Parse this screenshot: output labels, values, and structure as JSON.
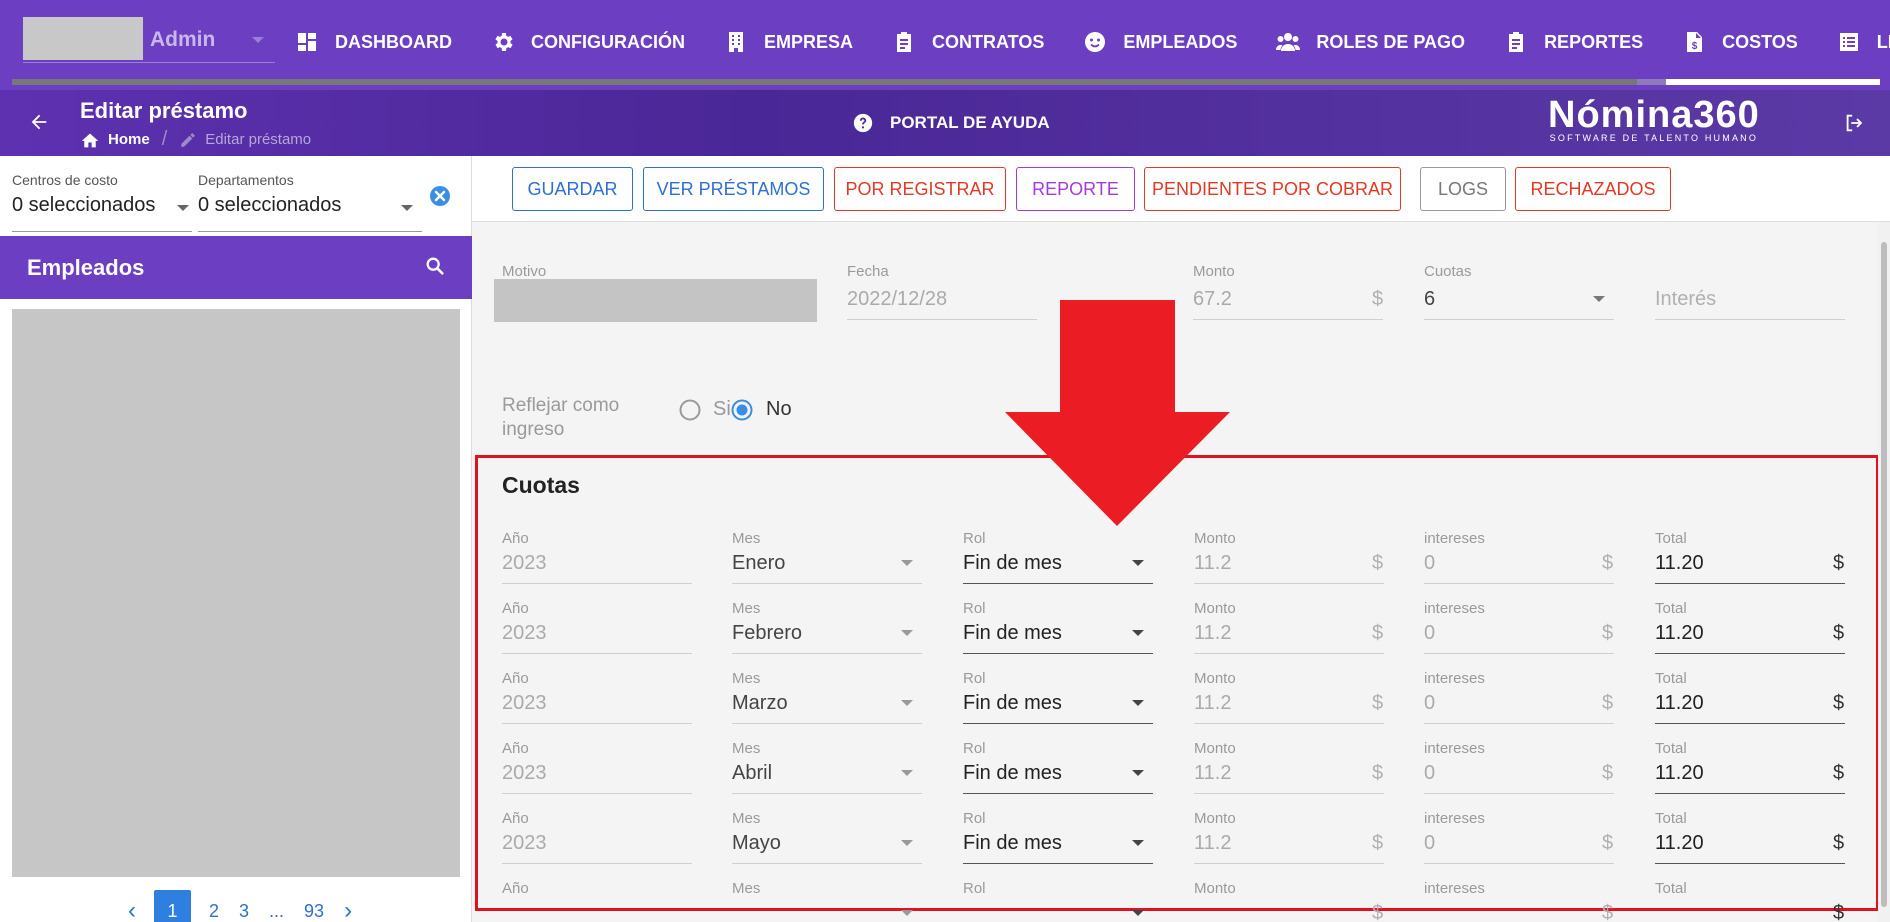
{
  "topnav": {
    "user": "Admin",
    "items": [
      {
        "label": "DASHBOARD",
        "icon": "dashboard-icon"
      },
      {
        "label": "CONFIGURACIÓN",
        "icon": "gear-icon"
      },
      {
        "label": "EMPRESA",
        "icon": "building-icon"
      },
      {
        "label": "CONTRATOS",
        "icon": "clipboard-icon"
      },
      {
        "label": "EMPLEADOS",
        "icon": "face-icon"
      },
      {
        "label": "ROLES DE PAGO",
        "icon": "people-icon"
      },
      {
        "label": "REPORTES",
        "icon": "clipboard-icon"
      },
      {
        "label": "COSTOS",
        "icon": "document-dollar-icon"
      },
      {
        "label": "LIQUIDACIONES",
        "icon": "list-icon"
      }
    ],
    "progress": 0.87
  },
  "header": {
    "title": "Editar préstamo",
    "breadcrumb_home": "Home",
    "breadcrumb_current": "Editar préstamo",
    "help": "PORTAL DE AYUDA",
    "logo": "Nómina360",
    "logo_sub": "SOFTWARE DE TALENTO HUMANO"
  },
  "filters": {
    "centros_label": "Centros de costo",
    "centros_value": "0 seleccionados",
    "departamentos_label": "Departamentos",
    "departamentos_value": "0 seleccionados"
  },
  "employees": {
    "title": "Empleados",
    "pages": [
      "1",
      "2",
      "3",
      "...",
      "93"
    ],
    "active_page": "1"
  },
  "toolbar": {
    "buttons": [
      "GUARDAR",
      "VER PRÉSTAMOS",
      "POR REGISTRAR",
      "REPORTE",
      "PENDIENTES POR COBRAR",
      "LOGS",
      "RECHAZADOS"
    ]
  },
  "loan": {
    "motivo_label": "Motivo",
    "fecha_label": "Fecha",
    "fecha_value": "2022/12/28",
    "monto_label": "Monto",
    "monto_value": "67.2",
    "cuotas_label": "Cuotas",
    "cuotas_value": "6",
    "interes_placeholder": "Interés",
    "currency": "$",
    "reflejar_label": "Reflejar como ingreso",
    "radio_si": "Si",
    "radio_no": "No",
    "radio_selected": "No"
  },
  "cuotas": {
    "title": "Cuotas",
    "labels": {
      "anio": "Año",
      "mes": "Mes",
      "rol": "Rol",
      "monto": "Monto",
      "intereses": "intereses",
      "total": "Total"
    },
    "rows": [
      {
        "anio": "2023",
        "mes": "Enero",
        "rol": "Fin de mes",
        "monto": "11.2",
        "intereses": "0",
        "total": "11.20"
      },
      {
        "anio": "2023",
        "mes": "Febrero",
        "rol": "Fin de mes",
        "monto": "11.2",
        "intereses": "0",
        "total": "11.20"
      },
      {
        "anio": "2023",
        "mes": "Marzo",
        "rol": "Fin de mes",
        "monto": "11.2",
        "intereses": "0",
        "total": "11.20"
      },
      {
        "anio": "2023",
        "mes": "Abril",
        "rol": "Fin de mes",
        "monto": "11.2",
        "intereses": "0",
        "total": "11.20"
      },
      {
        "anio": "2023",
        "mes": "Mayo",
        "rol": "Fin de mes",
        "monto": "11.2",
        "intereses": "0",
        "total": "11.20"
      },
      {
        "anio": "",
        "mes": "",
        "rol": "",
        "monto": "",
        "intereses": "",
        "total": ""
      }
    ]
  },
  "colors": {
    "brand_purple": "#6c3ec2",
    "highlight_red": "#e1121f",
    "link_blue": "#2e6fd1"
  }
}
